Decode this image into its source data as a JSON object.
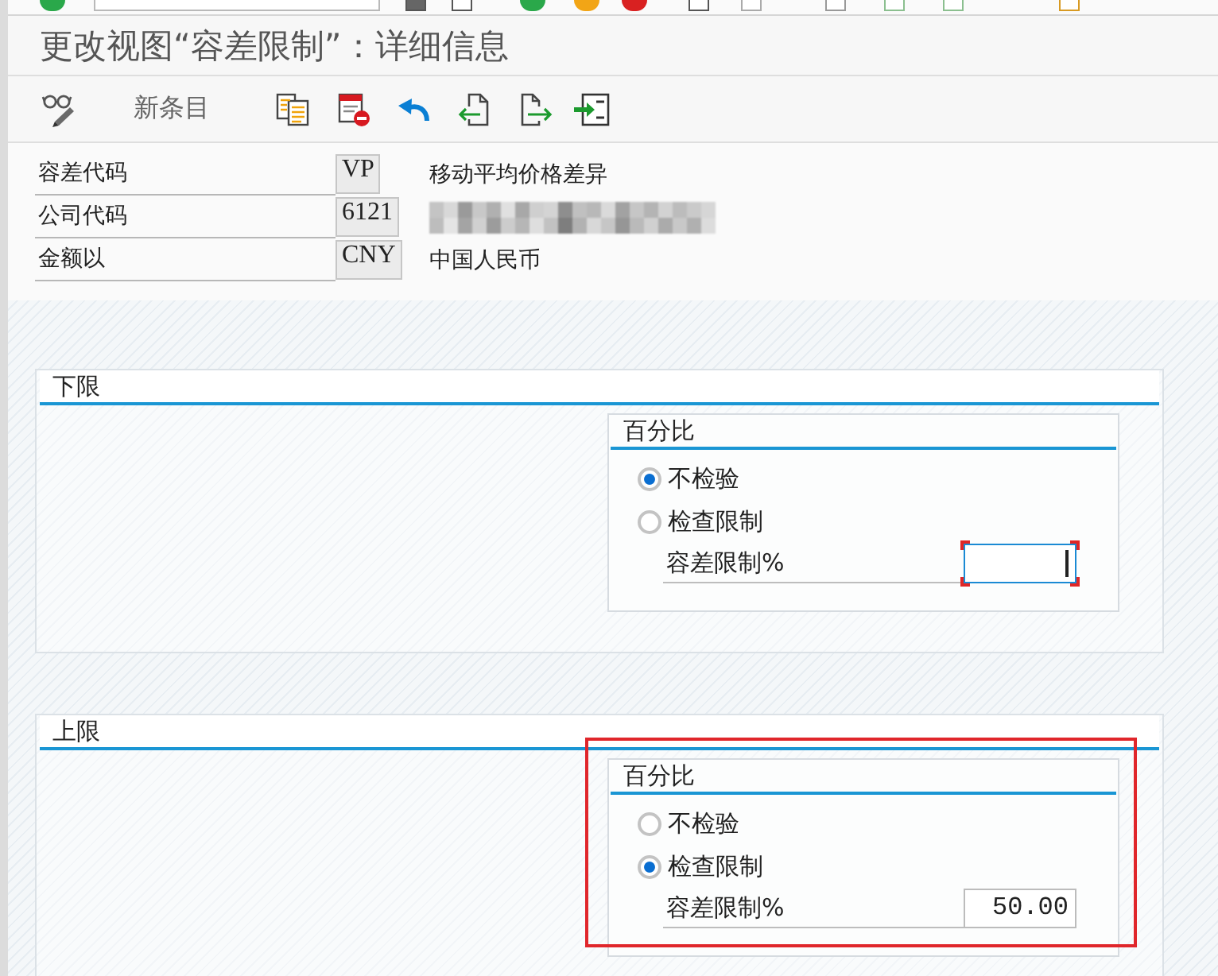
{
  "title": "更改视图“容差限制”：详细信息",
  "toolbar": {
    "new_entry": "新条目"
  },
  "header_fields": [
    {
      "label": "容差代码",
      "value": "VP",
      "description": "移动平均价格差异",
      "redacted": false
    },
    {
      "label": "公司代码",
      "value": "6121",
      "redacted": true
    },
    {
      "label": "金额以",
      "value": "CNY",
      "description": "中国人民币",
      "redacted": false
    }
  ],
  "groups": [
    {
      "title": "下限",
      "highlighted": false,
      "subgroup": {
        "title": "百分比",
        "options": [
          {
            "label": "不检验",
            "selected": true
          },
          {
            "label": "检查限制",
            "selected": false
          }
        ],
        "field": {
          "label": "容差限制%",
          "focused": true
        }
      }
    },
    {
      "title": "上限",
      "highlighted": true,
      "subgroup": {
        "title": "百分比",
        "options": [
          {
            "label": "不检验",
            "selected": false
          },
          {
            "label": "检查限制",
            "selected": true
          }
        ],
        "field": {
          "label": "容差限制%",
          "value": "50.00",
          "focused": false
        }
      }
    }
  ]
}
